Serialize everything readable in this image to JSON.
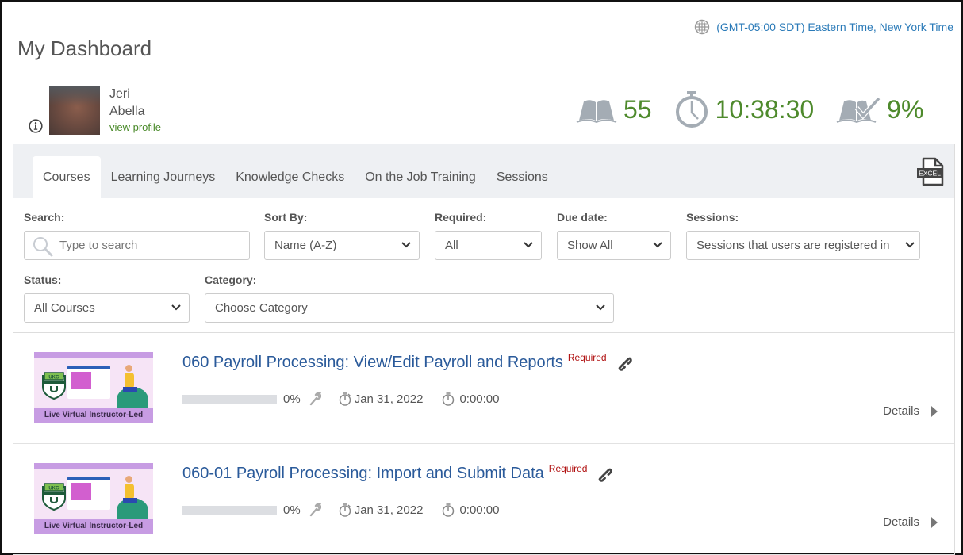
{
  "header": {
    "timezone": "(GMT-05:00 SDT) Eastern Time, New York Time",
    "title": "My Dashboard"
  },
  "user": {
    "first_name": "Jeri",
    "last_name": "Abella",
    "view_profile": "view profile"
  },
  "stats": {
    "courses_count": "55",
    "time_spent": "10:38:30",
    "completion": "9%"
  },
  "tabs": [
    {
      "label": "Courses",
      "active": true
    },
    {
      "label": "Learning Journeys"
    },
    {
      "label": "Knowledge Checks"
    },
    {
      "label": "On the Job Training"
    },
    {
      "label": "Sessions"
    }
  ],
  "export": {
    "label": "EXCEL"
  },
  "filters": {
    "search": {
      "label": "Search:",
      "placeholder": "Type to search",
      "value": ""
    },
    "sort_by": {
      "label": "Sort By:",
      "value": "Name (A-Z)"
    },
    "required": {
      "label": "Required:",
      "value": "All"
    },
    "due_date": {
      "label": "Due date:",
      "value": "Show All"
    },
    "sessions": {
      "label": "Sessions:",
      "value": "Sessions that users are registered in"
    },
    "status": {
      "label": "Status:",
      "value": "All Courses"
    },
    "category": {
      "label": "Category:",
      "value": "Choose Category"
    }
  },
  "courses": [
    {
      "title": "060 Payroll Processing: View/Edit Payroll and Reports",
      "badge": "Required",
      "thumbnail_caption": "Live Virtual Instructor-Led",
      "thumbnail_badge": "UKG",
      "progress": 0,
      "progress_label": "0%",
      "due_date": "Jan 31, 2022",
      "duration": "0:00:00",
      "details": "Details"
    },
    {
      "title": "060-01 Payroll Processing: Import and Submit Data",
      "badge": "Required",
      "thumbnail_caption": "Live Virtual Instructor-Led",
      "thumbnail_badge": "UKG",
      "progress": 0,
      "progress_label": "0%",
      "due_date": "Jan 31, 2022",
      "duration": "0:00:00",
      "details": "Details"
    }
  ],
  "colors": {
    "accent_green": "#4e8a2c",
    "link_blue": "#2a5a9a",
    "timezone_blue": "#2a7ab8",
    "required_red": "#b01010",
    "tab_bg": "#eef0f3"
  }
}
